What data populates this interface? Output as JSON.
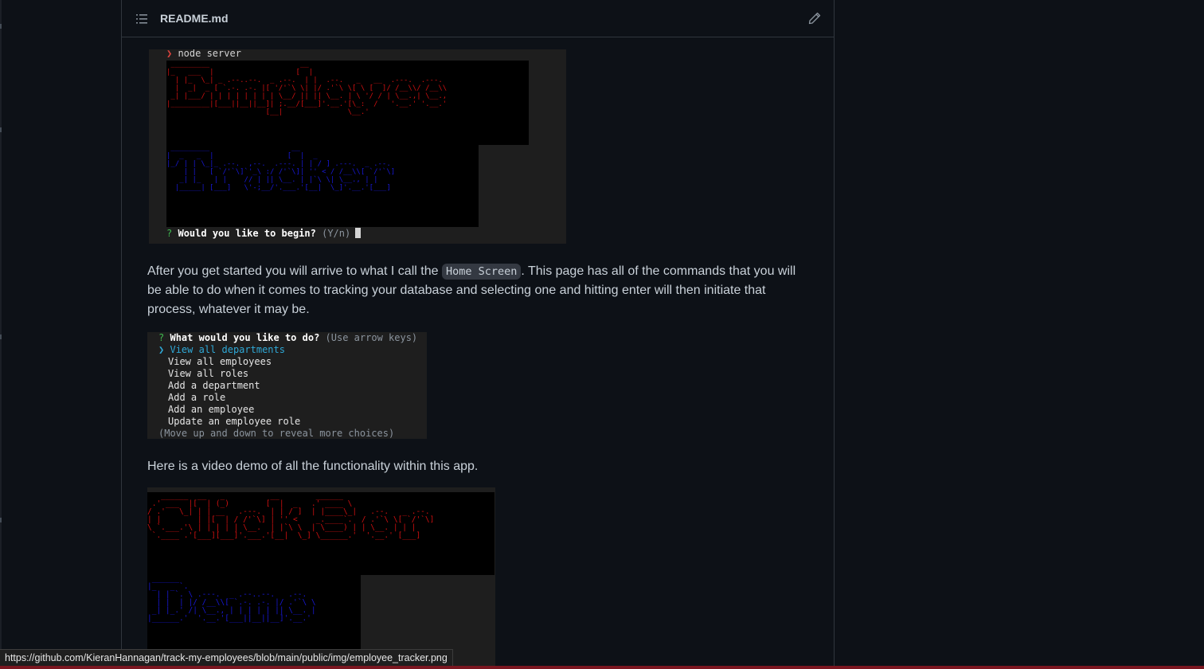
{
  "readme": {
    "title": "README.md"
  },
  "terminal1": {
    "command_prompt": "❯",
    "command": " node server",
    "ascii_top_word": "Employee",
    "ascii_bottom_word": "Tracker",
    "question_mark": "?",
    "question": "Would you like to begin?",
    "hint": "(Y/n)"
  },
  "paragraph1": {
    "before_code": "After you get started you will arrive to what I call the ",
    "code": "Home Screen",
    "after_code": ". This page has all of the commands that you will be able to do when it comes to tracking your database and selecting one and hitting enter will then initiate that process, whatever it may be."
  },
  "terminal2": {
    "question_mark": "?",
    "question": "What would you like to do?",
    "hint": "(Use arrow keys)",
    "selected_pointer": "❯",
    "selected": "View all departments",
    "items": [
      "View all employees",
      "View all roles",
      "Add a department",
      "Add a role",
      "Add an employee",
      "Update an employee role"
    ],
    "footer": "(Move up and down to reveal more choices)"
  },
  "paragraph2": {
    "text": "Here is a video demo of all the functionality within this app."
  },
  "terminal3": {
    "ascii_top_word": "Click for",
    "ascii_bottom_word": "Demo"
  },
  "status_bar": {
    "url": "https://github.com/KieranHannagan/track-my-employees/blob/main/public/img/employee_tracker.png"
  },
  "colors": {
    "background": "#0d1117",
    "border": "#30363d",
    "text": "#c9d1d9",
    "ascii_red": "#d01010",
    "ascii_blue": "#1818d6",
    "selection_cyan": "#2fa8d6",
    "prompt_green": "#3fb950"
  },
  "icons": {
    "toc": "list-unordered-icon",
    "edit": "pencil-icon"
  }
}
